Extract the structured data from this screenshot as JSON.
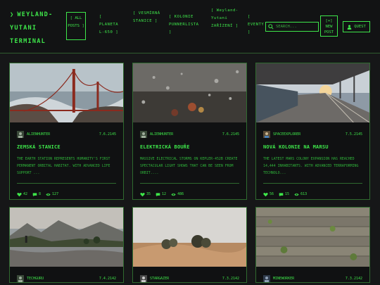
{
  "header": {
    "logo": "WEYLAND-YUTANI TERMINAL",
    "nav": [
      {
        "label": "[ ALL POSTS ]"
      },
      {
        "label": "[ PLANETA L-650 ]"
      },
      {
        "label": "[ VESMÍRNÁ STANICE ]"
      },
      {
        "label": "[ KOLONIE PUNNERLISTA ]"
      },
      {
        "label": "[ Weyland-Yutani ZAŘÍZENÍ ]"
      },
      {
        "label": "[ EVENTY ]"
      }
    ],
    "search_placeholder": "SEARCH...",
    "new_post": "[+] NEW POST",
    "quest": "QUEST"
  },
  "posts": [
    {
      "author": "ALIENHUNTER",
      "date": "7.6.2145",
      "title": "ZEMSKÁ STANICE",
      "excerpt": "THE EARTH STATION REPRESENTS HUMANITY'S FIRST PERMANENT ORBITAL HABITAT. WITH ADVANCED LIFE SUPPORT ...",
      "likes": "42",
      "comments": "8",
      "views": "127",
      "image": "bridge"
    },
    {
      "author": "ALIENHUNTER",
      "date": "7.6.2145",
      "title": "ELEKTRICKÁ BOUŘE",
      "excerpt": "MASSIVE ELECTRICAL STORMS ON KEPLER-452B CREATE SPECTACULAR LIGHT SHOWS THAT CAN BE SEEN FROM ORBIT....",
      "likes": "35",
      "comments": "12",
      "views": "486",
      "image": "rain"
    },
    {
      "author": "SPACEEXPLORER",
      "date": "7.5.2145",
      "title": "NOVÁ KOLONIE NA MARSU",
      "excerpt": "THE LATEST MARS COLONY EXPANSION HAS REACHED 14,444 INHABITANTS. WITH ADVANCED TERRAFORMING TECHNOLO...",
      "likes": "56",
      "comments": "15",
      "views": "613",
      "image": "station"
    },
    {
      "author": "TECHGURU",
      "date": "7.4.2142",
      "title": "",
      "excerpt": "",
      "likes": "",
      "comments": "",
      "views": "",
      "image": "lake"
    },
    {
      "author": "STARGAZER",
      "date": "7.3.2142",
      "title": "",
      "excerpt": "",
      "likes": "",
      "comments": "",
      "views": "",
      "image": "desert"
    },
    {
      "author": "MINEWORKER",
      "date": "7.3.2142",
      "title": "",
      "excerpt": "",
      "likes": "",
      "comments": "",
      "views": "",
      "image": "wood"
    }
  ]
}
